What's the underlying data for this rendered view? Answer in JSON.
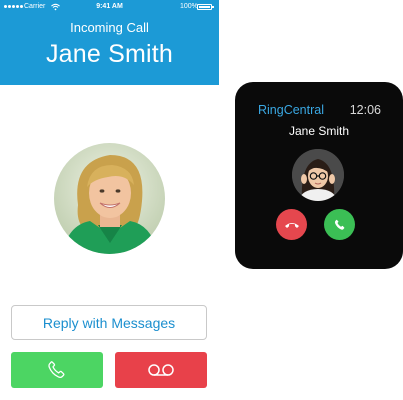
{
  "phone": {
    "status_bar": {
      "carrier": "Carrier",
      "time": "9:41 AM",
      "battery": "100%"
    },
    "header": {
      "label": "Incoming Call",
      "caller_name": "Jane Smith"
    },
    "actions": {
      "reply_label": "Reply with Messages",
      "answer_icon": "phone-icon",
      "voicemail_icon": "voicemail-icon"
    }
  },
  "watch": {
    "app_name": "RingCentral",
    "time": "12:06",
    "caller_name": "Jane Smith",
    "decline_icon": "hang-up-icon",
    "accept_icon": "phone-icon"
  },
  "colors": {
    "header_blue": "#1c9ad6",
    "accent_blue": "#1b8fcf",
    "answer_green": "#4cd563",
    "decline_red": "#e8414a",
    "watch_bg": "#0a0a0a"
  }
}
